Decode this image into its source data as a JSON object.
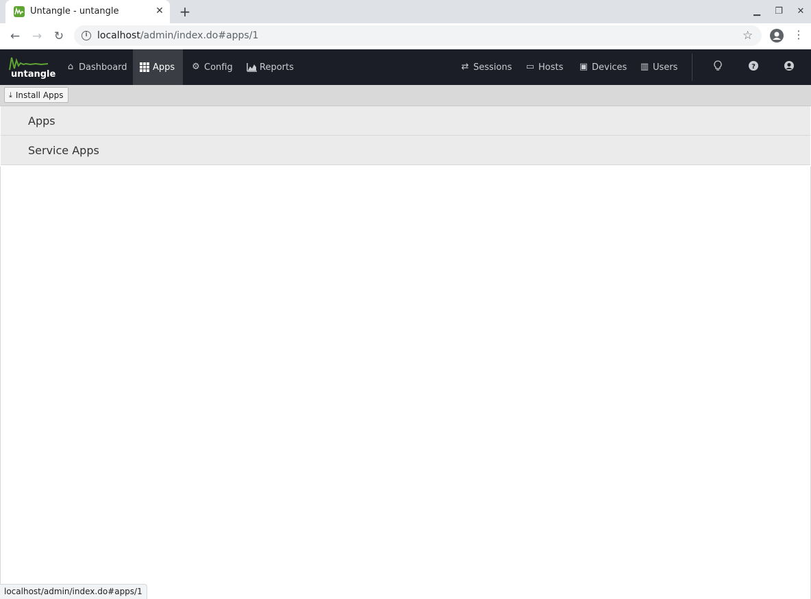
{
  "browser": {
    "tab_title": "Untangle - untangle",
    "url_host": "localhost",
    "url_path": "/admin/index.do#apps/1",
    "status_url": "localhost/admin/index.do#apps/1"
  },
  "brand": {
    "logo_text": "untangle",
    "accent_color": "#5fa533"
  },
  "nav": {
    "items": [
      {
        "label": "Dashboard",
        "icon": "home-icon"
      },
      {
        "label": "Apps",
        "icon": "grid-icon",
        "active": true
      },
      {
        "label": "Config",
        "icon": "gear-icon"
      },
      {
        "label": "Reports",
        "icon": "area-chart-icon"
      }
    ],
    "right_items": [
      {
        "label": "Sessions",
        "icon": "sessions-icon"
      },
      {
        "label": "Hosts",
        "icon": "hosts-icon"
      },
      {
        "label": "Devices",
        "icon": "monitor-icon"
      },
      {
        "label": "Users",
        "icon": "users-icon"
      }
    ]
  },
  "toolbar": {
    "install_label": "Install Apps"
  },
  "groups": [
    {
      "title": "Apps"
    },
    {
      "title": "Service Apps"
    }
  ]
}
